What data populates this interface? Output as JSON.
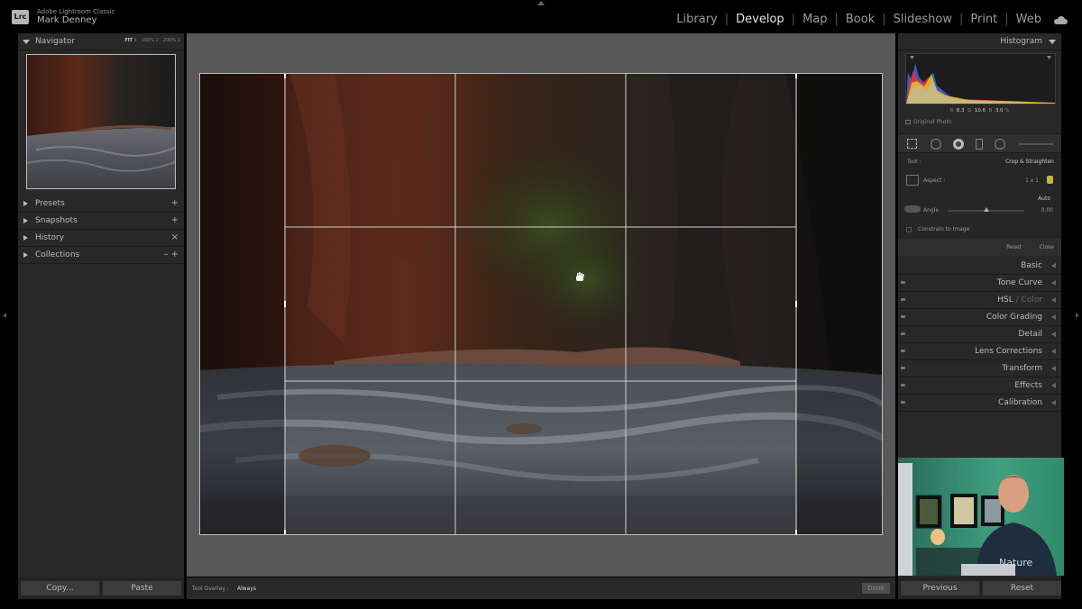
{
  "app": {
    "logo": "Lrc",
    "name": "Adobe Lightroom Classic",
    "user": "Mark Denney"
  },
  "modules": [
    "Library",
    "Develop",
    "Map",
    "Book",
    "Slideshow",
    "Print",
    "Web"
  ],
  "active_module": "Develop",
  "left_panel": {
    "navigator": {
      "label": "Navigator",
      "zoom_fit": "FIT",
      "zoom_1": "1",
      "zoom_100": "100%",
      "zoom_2": "2",
      "zoom_200": "200%",
      "zoom_3": "2"
    },
    "presets": {
      "label": "Presets",
      "action": "+"
    },
    "snapshots": {
      "label": "Snapshots",
      "action": "+"
    },
    "history": {
      "label": "History",
      "action": "×"
    },
    "collections": {
      "label": "Collections",
      "action": "– +"
    },
    "copy_button": "Copy...",
    "paste_button": "Paste"
  },
  "toolbar": {
    "overlay_label": "Tool Overlay :",
    "overlay_value": "Always",
    "done_button": "Done"
  },
  "right_panel": {
    "histogram": {
      "label": "Histogram",
      "r_label": "R",
      "r_value": "8.3",
      "g_label": "G",
      "g_value": "10.6",
      "b_label": "B",
      "b_value": "3.0",
      "pct": "%",
      "original_photo": "Original Photo"
    },
    "crop": {
      "tool_label": "Tool :",
      "tool_value": "Crop & Straighten",
      "aspect_label": "Aspect :",
      "aspect_value": "1 x 1",
      "auto_button": "Auto",
      "angle_label": "Angle",
      "angle_value": "0.00",
      "constrain_label": "Constrain to Image",
      "reset_button": "Reset",
      "close_button": "Close"
    },
    "sections": [
      {
        "label": "Basic"
      },
      {
        "label": "Tone Curve"
      },
      {
        "label": "HSL",
        "label_dim": " / Color"
      },
      {
        "label": "Color Grading"
      },
      {
        "label": "Detail"
      },
      {
        "label": "Lens Corrections"
      },
      {
        "label": "Transform"
      },
      {
        "label": "Effects"
      },
      {
        "label": "Calibration"
      }
    ],
    "previous_button": "Previous",
    "reset_button": "Reset"
  },
  "colors": {
    "accent_active": "#e6e6e6",
    "panel_bg": "#282828",
    "canvas_bg": "#585858",
    "histogram_red": "#e83030",
    "histogram_yellow": "#e0d020",
    "histogram_blue": "#3a6ae0"
  }
}
